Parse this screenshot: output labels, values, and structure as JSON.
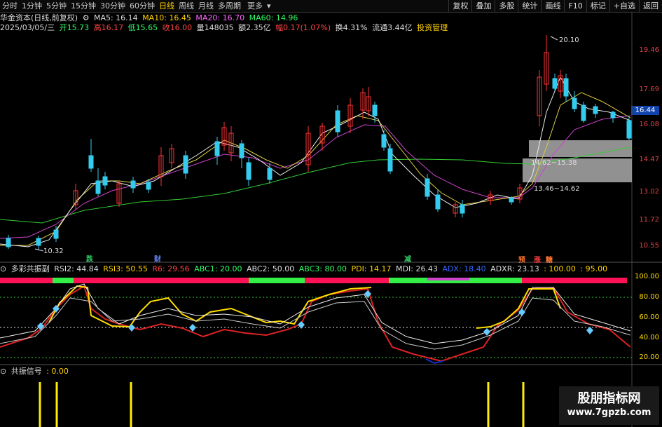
{
  "toolbar": {
    "periods": [
      "分时",
      "1分钟",
      "5分钟",
      "15分钟",
      "30分钟",
      "60分钟",
      "日线",
      "周线",
      "月线",
      "多周期",
      "更多"
    ],
    "selected": "日线",
    "tools": [
      "复权",
      "叠加",
      "多股",
      "统计",
      "画线",
      "F10",
      "标记",
      "+自选",
      "返回"
    ]
  },
  "header": {
    "name": "华金资本(日线,前复权)",
    "ma5": "MA5: 16.14",
    "ma10": "MA10: 16.45",
    "ma20": "MA20: 16.70",
    "ma60": "MA60: 14.96",
    "date": "2025/03/05/三",
    "open": "开15.73",
    "high": "高16.17",
    "low": "低15.65",
    "close": "收16.00",
    "vol": "量148035",
    "amt": "额2.35亿",
    "amp": "幅0.17(1.07%)",
    "turn": "换4.31%",
    "float": "流通3.44亿",
    "manage": "投资管理"
  },
  "price_axis": [
    "19.46",
    "17.69",
    "16.08",
    "14.47",
    "13.02",
    "11.72",
    "10.55"
  ],
  "current_price": "16.44",
  "annotations": {
    "high": "20.10",
    "low": "10.32",
    "range1": "14.62~15.38",
    "range2": "13.46~14.62"
  },
  "markers": [
    {
      "t": "跌",
      "color": "#33cc66"
    },
    {
      "t": "财",
      "color": "#6688ff"
    },
    {
      "t": "减",
      "color": "#33cc66"
    },
    {
      "t": "预",
      "color": "#ff7733"
    },
    {
      "t": "涨",
      "color": "#ff4444"
    },
    {
      "t": "糖",
      "color": "#ff7733"
    }
  ],
  "indicator": {
    "name": "多彩共振副",
    "rsi2": "RSI2: 44.84",
    "rsi3": "RSI3: 50.55",
    "r6": "R6: 29.56",
    "abc1": "ABC1: 20.00",
    "abc2": "ABC2: 50.00",
    "abc3": "ABC3: 80.00",
    "pdi": "PDI: 14.17",
    "mdi": "MDI: 26.43",
    "adx": "ADX: 18.40",
    "adxr": "ADXR: 23.13",
    "v100": ": 100.00",
    "v95": ": 95.00",
    "axis": [
      "100.00",
      "80.00",
      "60.00",
      "40.00",
      "20.00"
    ]
  },
  "signal": {
    "name": "共振信号",
    "value": ": 0.00"
  },
  "watermark": {
    "cn": "股朋指标网",
    "url": "www.7gpzb.com"
  }
}
